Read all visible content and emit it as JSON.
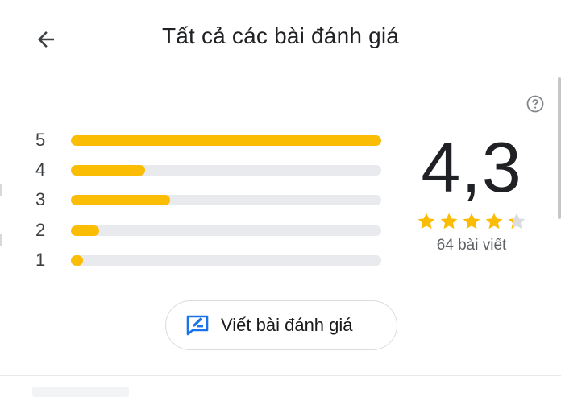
{
  "header": {
    "title": "Tất cả các bài đánh giá",
    "back_icon": "arrow-back-icon"
  },
  "help_icon": "help-circle-icon",
  "distribution": [
    {
      "label": "5",
      "fraction": 1.0
    },
    {
      "label": "4",
      "fraction": 0.24
    },
    {
      "label": "3",
      "fraction": 0.32
    },
    {
      "label": "2",
      "fraction": 0.09
    },
    {
      "label": "1",
      "fraction": 0.04
    }
  ],
  "summary": {
    "rating": "4,3",
    "stars_value": 4.3,
    "count_text": "64 bài viết"
  },
  "write_review": {
    "label": "Viết bài đánh giá",
    "icon": "rate-review-icon"
  },
  "colors": {
    "bar_fill": "#fbbc04",
    "bar_track": "#e8eaed",
    "star_filled": "#fbbc04",
    "star_empty": "#dadce0",
    "accent_blue": "#1a73e8"
  }
}
